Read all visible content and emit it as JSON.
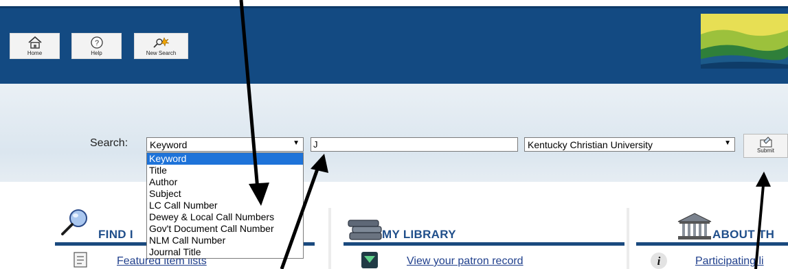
{
  "header": {
    "buttons": [
      {
        "label": "Home",
        "icon": "home-icon"
      },
      {
        "label": "Help",
        "icon": "help-icon"
      },
      {
        "label": "New Search",
        "icon": "new-search-icon"
      }
    ]
  },
  "search": {
    "label": "Search:",
    "type_selected": "Keyword",
    "query_value": "J",
    "library_selected": "Kentucky Christian University",
    "submit_label": "Submit",
    "type_options": [
      "Keyword",
      "Title",
      "Author",
      "Subject",
      "LC Call Number",
      "Dewey & Local Call Numbers",
      "Gov't Document Call Number",
      "NLM Call Number",
      "Journal Title"
    ]
  },
  "sections": {
    "find": {
      "title": "FIND I",
      "link": "Featured item lists"
    },
    "my_library": {
      "title": "MY LIBRARY",
      "link": "View your patron record"
    },
    "about": {
      "title": "ABOUT TH",
      "link": "Participating li"
    }
  },
  "colors": {
    "header_bg": "#134a82",
    "selected_option_bg": "#1e73d9",
    "section_title": "#1f4e8a",
    "link": "#1f3f8c"
  }
}
